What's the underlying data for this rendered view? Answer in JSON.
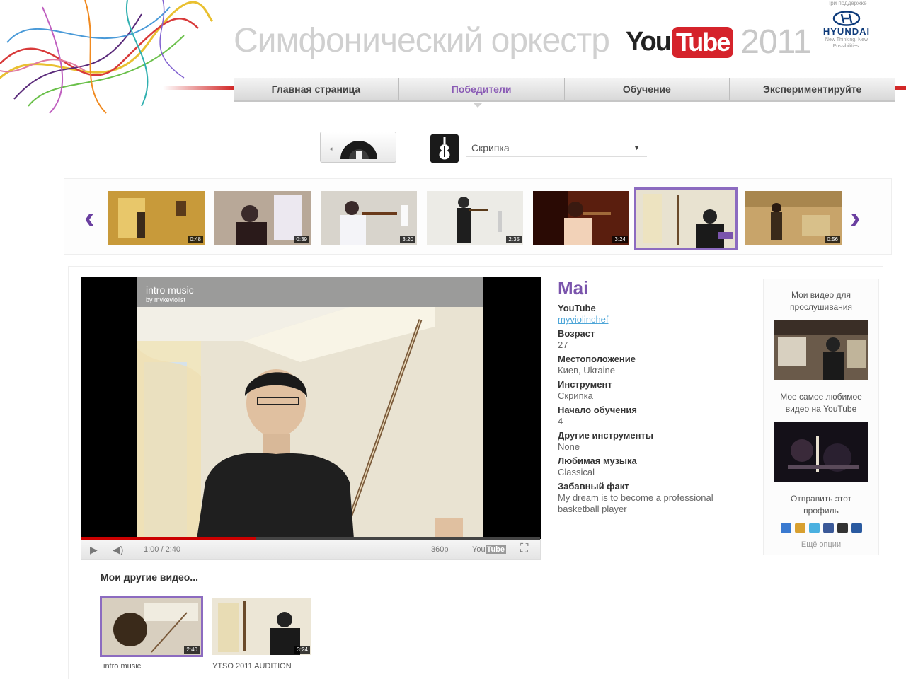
{
  "header": {
    "title": "Симфонический оркестр",
    "youtube_you": "You",
    "youtube_tube": "Tube",
    "year": "2011",
    "sponsor_top": "При поддержке",
    "sponsor_name": "HYUNDAI",
    "sponsor_sub": "New Thinking. New Possibilities."
  },
  "nav": {
    "items": [
      "Главная страница",
      "Победители",
      "Обучение",
      "Экспериментируйте"
    ],
    "active_index": 1
  },
  "filter": {
    "instrument_selected": "Скрипка",
    "icon_names": [
      "record-dial-icon",
      "violin-icon",
      "dropdown-arrow-icon"
    ]
  },
  "carousel": {
    "durations": [
      "0:48",
      "0:39",
      "3:20",
      "2:35",
      "3:24",
      "",
      "0:56"
    ],
    "selected_index": 5
  },
  "player": {
    "video_title": "intro music",
    "video_by": "by mykeviolist",
    "time": "1:00 / 2:40",
    "quality": "360p",
    "progress": 0.38,
    "fullscreen_icon": "fullscreen-icon"
  },
  "profile": {
    "name": "Mai",
    "youtube_label": "YouTube",
    "youtube_value": "myviolinchef",
    "age_label": "Возраст",
    "age_value": "27",
    "location_label": "Местоположение",
    "location_value": "Киев, Ukraine",
    "instrument_label": "Инструмент",
    "instrument_value": "Скрипка",
    "start_label": "Начало обучения",
    "start_value": "4",
    "other_label": "Другие инструменты",
    "other_value": "None",
    "music_label": "Любимая музыка",
    "music_value": "Classical",
    "fact_label": "Забавный факт",
    "fact_value": "My dream is to become a professional basketball player"
  },
  "sidebar": {
    "audition_title": "Мои видео для прослушивания",
    "favorite_title": "Мое самое любимое видео на YouTube",
    "share_title": "Отправить этот профиль",
    "share_icons": [
      "delicious-icon",
      "digg-icon",
      "twitter-icon",
      "facebook-icon",
      "myspace-icon",
      "bookmark-icon"
    ],
    "more_options": "Ещё опции"
  },
  "other_videos": {
    "heading": "Мои другие видео...",
    "items": [
      {
        "caption": "intro music",
        "duration": "2:40"
      },
      {
        "caption": "YTSO 2011 AUDITION",
        "duration": "3:24"
      }
    ]
  },
  "colors": {
    "accent_purple": "#7a54ac",
    "youtube_red": "#d5232b",
    "link_blue": "#4ea6d8"
  }
}
